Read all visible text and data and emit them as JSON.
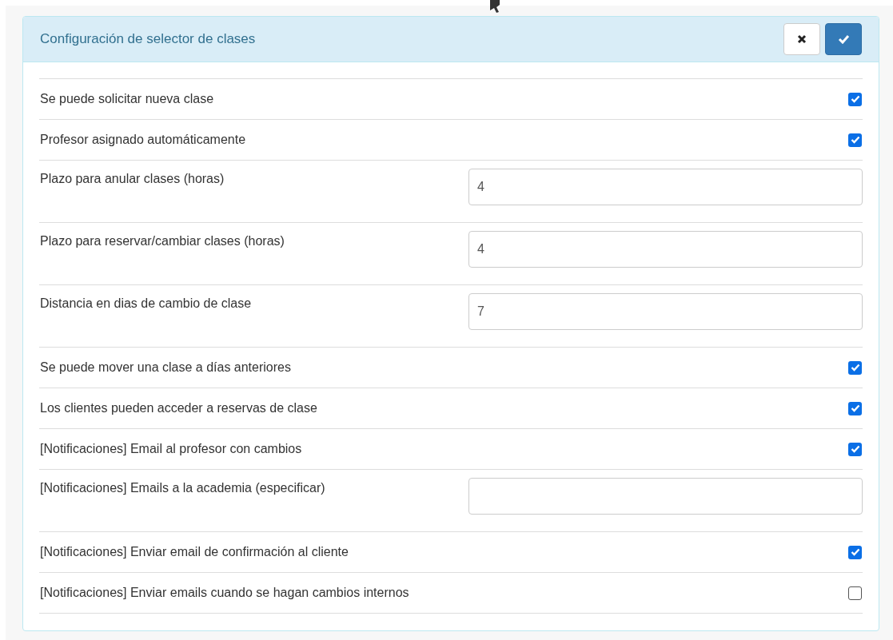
{
  "panel": {
    "title": "Configuración de selector de clases",
    "buttons": [
      {
        "kind": "cancel"
      },
      {
        "kind": "confirm"
      }
    ]
  },
  "settings": [
    {
      "kind": "checkbox",
      "label": "Se puede solicitar nueva clase",
      "checked": true
    },
    {
      "kind": "checkbox",
      "label": "Profesor asignado automáticamente",
      "checked": true
    },
    {
      "kind": "input",
      "label": "Plazo para anular clases (horas)",
      "value": "4"
    },
    {
      "kind": "input",
      "label": "Plazo para reservar/cambiar clases (horas)",
      "value": "4"
    },
    {
      "kind": "input",
      "label": "Distancia en dias de cambio de clase",
      "value": "7"
    },
    {
      "kind": "checkbox",
      "label": "Se puede mover una clase a días anteriores",
      "checked": true
    },
    {
      "kind": "checkbox",
      "label": "Los clientes pueden acceder a reservas de clase",
      "checked": true
    },
    {
      "kind": "checkbox",
      "label": "[Notificaciones] Email al profesor con cambios",
      "checked": true
    },
    {
      "kind": "input",
      "label": "[Notificaciones] Emails a la academia (especificar)"
    },
    {
      "kind": "checkbox",
      "label": "[Notificaciones] Enviar email de confirmación al cliente",
      "checked": true
    },
    {
      "kind": "checkbox",
      "label": "[Notificaciones] Enviar emails cuando se hagan cambios internos",
      "checked": false
    }
  ]
}
